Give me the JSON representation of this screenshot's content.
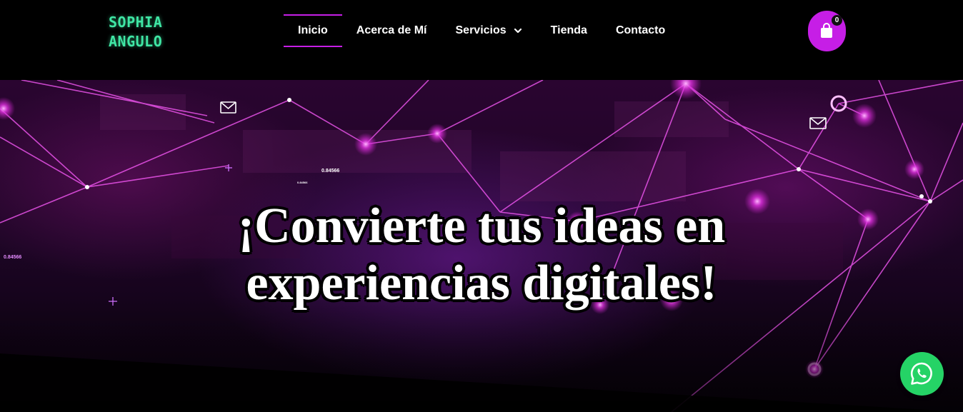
{
  "brand": {
    "line1": "SOPHIA",
    "line2": "ANGULO",
    "color": "#3fe6a4"
  },
  "nav": {
    "items": [
      {
        "label": "Inicio",
        "active": true
      },
      {
        "label": "Acerca de Mí"
      },
      {
        "label": "Servicios",
        "has_dropdown": true
      },
      {
        "label": "Tienda"
      },
      {
        "label": "Contacto"
      }
    ],
    "accent": "#c61ee6"
  },
  "cart": {
    "count": "0",
    "icon": "shopping-bag-icon"
  },
  "hero": {
    "title_line1": "¡Convierte tus ideas en",
    "title_line2": "experiencias digitales!",
    "decor_numbers": [
      "0.84566",
      "0.84566",
      "0.84566"
    ]
  },
  "whatsapp": {
    "icon": "whatsapp-icon",
    "color": "#25d366"
  }
}
